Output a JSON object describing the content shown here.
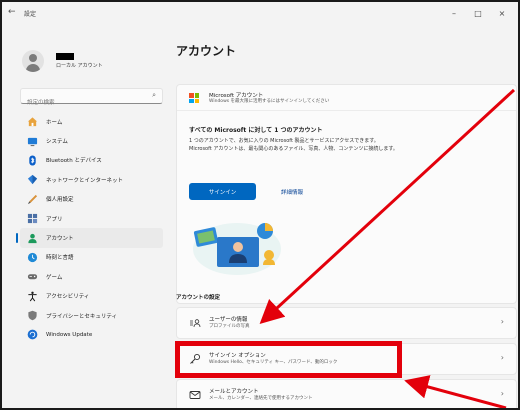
{
  "window": {
    "title": "設定",
    "back_icon": "back-arrow-icon",
    "controls": [
      "–",
      "□",
      "×"
    ]
  },
  "profile": {
    "account_type": "ローカル アカウント"
  },
  "search": {
    "placeholder": "設定の検索",
    "icon": "search-icon"
  },
  "sidebar": {
    "items": [
      {
        "label": "ホーム",
        "icon": "home-icon"
      },
      {
        "label": "システム",
        "icon": "system-icon"
      },
      {
        "label": "Bluetooth とデバイス",
        "icon": "bluetooth-icon"
      },
      {
        "label": "ネットワークとインターネット",
        "icon": "network-icon"
      },
      {
        "label": "個人用設定",
        "icon": "personalization-icon"
      },
      {
        "label": "アプリ",
        "icon": "apps-icon"
      },
      {
        "label": "アカウント",
        "icon": "accounts-icon",
        "selected": true
      },
      {
        "label": "時刻と言語",
        "icon": "time-language-icon"
      },
      {
        "label": "ゲーム",
        "icon": "gaming-icon"
      },
      {
        "label": "アクセシビリティ",
        "icon": "accessibility-icon"
      },
      {
        "label": "プライバシーとセキュリティ",
        "icon": "privacy-icon"
      },
      {
        "label": "Windows Update",
        "icon": "windows-update-icon"
      }
    ]
  },
  "main": {
    "title": "アカウント",
    "microsoft_account": {
      "title": "Microsoft アカウント",
      "subtitle": "Windows を最大限に活用するにはサインインしてください",
      "body_title": "すべての Microsoft に対して 1 つのアカウント",
      "body_desc": "1 つのアカウントで、お気に入りの Microsoft 製品とサービスにアクセスできます。Microsoft アカウントは、最も関心のあるファイル、写真、人物、コンテンツに接続します。",
      "signin_label": "サインイン",
      "details_label": "詳細情報"
    },
    "section_title": "アカウントの設定",
    "settings": [
      {
        "title": "ユーザーの情報",
        "subtitle": "プロファイルの写真",
        "icon": "user-info-icon"
      },
      {
        "title": "サインイン オプション",
        "subtitle": "Windows Hello、セキュリティ キー、パスワード、動的ロック",
        "icon": "key-icon"
      },
      {
        "title": "メールとアカウント",
        "subtitle": "メール、カレンダー、連絡先で使用するアカウント",
        "icon": "mail-icon"
      }
    ]
  },
  "colors": {
    "accent": "#0067c0",
    "annotation": "#e3000b"
  }
}
